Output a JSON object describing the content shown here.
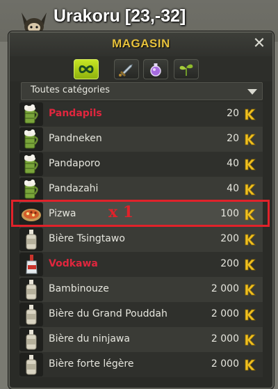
{
  "map": {
    "title": "Urakoru [23,-32]"
  },
  "shop": {
    "title": "MAGASIN",
    "close_icon": "close-icon",
    "tabs": [
      {
        "icon": "infinity-icon",
        "active": true
      },
      {
        "icon": "sword-icon",
        "active": false
      },
      {
        "icon": "potion-icon",
        "active": false
      },
      {
        "icon": "sprout-icon",
        "active": false
      }
    ],
    "category": {
      "selected": "Toutes catégories"
    },
    "currency_icon": "kama-icon",
    "items": [
      {
        "name": "Pandapils",
        "price": "20",
        "icon": "bamboo-mug-icon",
        "special": true
      },
      {
        "name": "Pandneken",
        "price": "20",
        "icon": "bamboo-mug-icon",
        "special": false
      },
      {
        "name": "Pandaporo",
        "price": "40",
        "icon": "bamboo-mug-icon",
        "special": false
      },
      {
        "name": "Pandazahi",
        "price": "40",
        "icon": "bamboo-mug-icon",
        "special": false
      },
      {
        "name": "Pizwa",
        "price": "100",
        "icon": "pizza-icon",
        "special": false,
        "selected": true
      },
      {
        "name": "Bière Tsingtawo",
        "price": "200",
        "icon": "beer-bottle-icon",
        "special": false
      },
      {
        "name": "Vodkawa",
        "price": "200",
        "icon": "vodka-bottle-icon",
        "special": true
      },
      {
        "name": "Bambinouze",
        "price": "2 000",
        "icon": "beer-bottle-icon",
        "special": false
      },
      {
        "name": "Bière du Grand Pouddah",
        "price": "2 000",
        "icon": "beer-bottle-icon",
        "special": false
      },
      {
        "name": "Bière du ninjawa",
        "price": "2 000",
        "icon": "beer-bottle-icon",
        "special": false
      },
      {
        "name": "Bière forte légère",
        "price": "2 000",
        "icon": "beer-bottle-icon",
        "special": false
      }
    ]
  },
  "annotation": {
    "quantity": "x 1",
    "color": "#e1222a"
  },
  "colors": {
    "title": "#e7c23c",
    "special_item": "#e0263e",
    "kama": "#f0c020",
    "active_tab": "#a8cc18"
  }
}
